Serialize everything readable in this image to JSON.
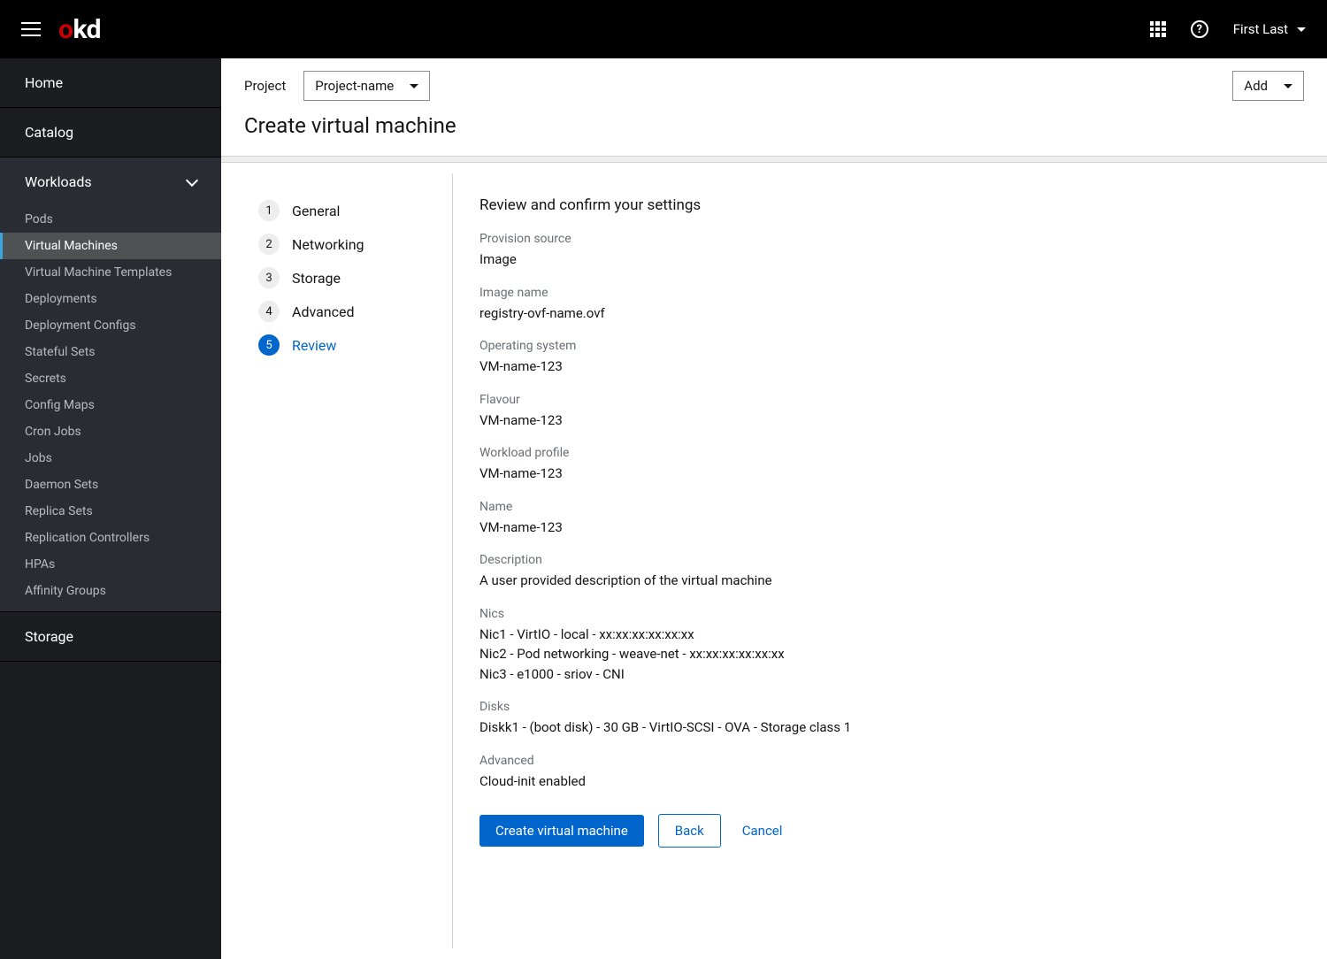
{
  "topbar": {
    "logo": {
      "o": "o",
      "kd": "kd"
    },
    "help": "?",
    "user": "First Last"
  },
  "sidebar": {
    "home": "Home",
    "catalog": "Catalog",
    "workloads": {
      "label": "Workloads",
      "items": [
        "Pods",
        "Virtual Machines",
        "Virtual Machine Templates",
        "Deployments",
        "Deployment Configs",
        "Stateful Sets",
        "Secrets",
        "Config Maps",
        "Cron Jobs",
        "Jobs",
        "Daemon Sets",
        "Replica Sets",
        "Replication Controllers",
        "HPAs",
        "Affinity Groups"
      ],
      "activeIndex": 1
    },
    "storage": "Storage"
  },
  "toolbar": {
    "projectLabel": "Project",
    "projectValue": "Project-name",
    "addLabel": "Add"
  },
  "page": {
    "title": "Create virtual machine"
  },
  "wizard": {
    "steps": [
      {
        "num": "1",
        "label": "General"
      },
      {
        "num": "2",
        "label": "Networking"
      },
      {
        "num": "3",
        "label": "Storage"
      },
      {
        "num": "4",
        "label": "Advanced"
      },
      {
        "num": "5",
        "label": "Review"
      }
    ],
    "activeIndex": 4
  },
  "review": {
    "title": "Review and confirm your settings",
    "fields": {
      "provisionSource": {
        "label": "Provision source",
        "value": "Image"
      },
      "imageName": {
        "label": "Image name",
        "value": "registry-ovf-name.ovf"
      },
      "os": {
        "label": "Operating system",
        "value": "VM-name-123"
      },
      "flavour": {
        "label": "Flavour",
        "value": "VM-name-123"
      },
      "workloadProfile": {
        "label": "Workload profile",
        "value": "VM-name-123"
      },
      "name": {
        "label": "Name",
        "value": "VM-name-123"
      },
      "description": {
        "label": "Description",
        "value": "A user provided description of the virtual machine"
      },
      "nics": {
        "label": "Nics",
        "lines": [
          "Nic1 - VirtIO - local - xx:xx:xx:xx:xx:xx",
          "Nic2 - Pod networking - weave-net - xx:xx:xx:xx:xx:xx",
          "Nic3 - e1000 - sriov - CNI"
        ]
      },
      "disks": {
        "label": "Disks",
        "lines": [
          "Diskk1 - (boot disk) - 30 GB - VirtIO-SCSI - OVA - Storage class 1"
        ]
      },
      "advanced": {
        "label": "Advanced",
        "value": "Cloud-init enabled"
      }
    }
  },
  "actions": {
    "create": "Create virtual machine",
    "back": "Back",
    "cancel": "Cancel"
  }
}
